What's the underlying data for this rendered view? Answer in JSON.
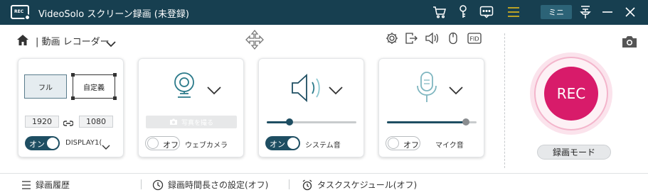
{
  "app": {
    "title": "VideoSolo スクリーン録画 (未登録)",
    "logo_text": "REC",
    "mini_label": "ミニ",
    "title_icons": [
      "cart-icon",
      "key-icon",
      "chat-icon",
      "menu-icon",
      "pin-icon",
      "minimize-icon",
      "close-icon"
    ]
  },
  "toolbar": {
    "mode_label": "| 動画 レコーダー",
    "icons": [
      "gear-icon",
      "export-icon",
      "speaker-icon",
      "mouse-icon",
      "fps-icon"
    ],
    "fps_label": "FID"
  },
  "display": {
    "full_label": "フル",
    "custom_label": "自定義",
    "width": "1920",
    "height": "1080",
    "toggle": "オン",
    "toggle_state": "on",
    "source": "DISPLAY1("
  },
  "webcam": {
    "photo_label": "写真を撮る",
    "toggle": "オフ",
    "toggle_state": "off",
    "label": "ウェブカメラ"
  },
  "system_sound": {
    "toggle": "オン",
    "toggle_state": "on",
    "label": "システム音",
    "volume": 0.25
  },
  "microphone": {
    "toggle": "オフ",
    "toggle_state": "off",
    "label": "マイク音",
    "volume": 0.88
  },
  "record": {
    "button_label": "REC",
    "mode_label": "録画モード",
    "accent": "#d81b6a"
  },
  "bottom": {
    "history": "録画履歴",
    "duration": "録画時間長さの設定(オフ)",
    "schedule": "タスクスケジュール(オフ)"
  },
  "colors": {
    "titlebar": "#173f50",
    "toggle_on": "#1e4e62"
  }
}
